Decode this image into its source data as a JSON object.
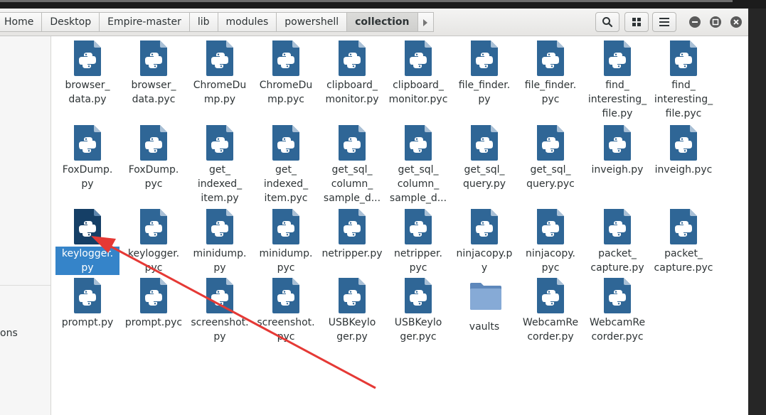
{
  "breadcrumbs": [
    "Home",
    "Desktop",
    "Empire-master",
    "lib",
    "modules",
    "powershell",
    "collection"
  ],
  "toolbar": {
    "search_icon": "search-icon",
    "view_icon": "grid-view-icon",
    "menu_icon": "hamburger-menu-icon"
  },
  "sidebar": {
    "partial_item": "ons"
  },
  "colors": {
    "selection": "#3584c9",
    "file_icon": "#2f6696",
    "folder": "#7aa2d0",
    "arrow": "#e53935"
  },
  "files": [
    {
      "name": "browser_\ndata.py",
      "type": "python"
    },
    {
      "name": "browser_\ndata.pyc",
      "type": "python"
    },
    {
      "name": "ChromeDu\nmp.py",
      "type": "python"
    },
    {
      "name": "ChromeDu\nmp.pyc",
      "type": "python"
    },
    {
      "name": "clipboard_\nmonitor.py",
      "type": "python"
    },
    {
      "name": "clipboard_\nmonitor.pyc",
      "type": "python"
    },
    {
      "name": "file_finder.\npy",
      "type": "python"
    },
    {
      "name": "file_finder.\npyc",
      "type": "python"
    },
    {
      "name": "find_\ninteresting_\nfile.py",
      "type": "python"
    },
    {
      "name": "find_\ninteresting_\nfile.pyc",
      "type": "python"
    },
    {
      "name": "FoxDump.\npy",
      "type": "python"
    },
    {
      "name": "FoxDump.\npyc",
      "type": "python"
    },
    {
      "name": "get_\nindexed_\nitem.py",
      "type": "python"
    },
    {
      "name": "get_\nindexed_\nitem.pyc",
      "type": "python"
    },
    {
      "name": "get_sql_\ncolumn_\nsample_d...",
      "type": "python"
    },
    {
      "name": "get_sql_\ncolumn_\nsample_d...",
      "type": "python"
    },
    {
      "name": "get_sql_\nquery.py",
      "type": "python"
    },
    {
      "name": "get_sql_\nquery.pyc",
      "type": "python"
    },
    {
      "name": "inveigh.py",
      "type": "python"
    },
    {
      "name": "inveigh.pyc",
      "type": "python"
    },
    {
      "name": "keylogger.\npy",
      "type": "python",
      "selected": true
    },
    {
      "name": "keylogger.\npyc",
      "type": "python"
    },
    {
      "name": "minidump.\npy",
      "type": "python"
    },
    {
      "name": "minidump.\npyc",
      "type": "python"
    },
    {
      "name": "netripper.py",
      "type": "python"
    },
    {
      "name": "netripper.\npyc",
      "type": "python"
    },
    {
      "name": "ninjacopy.py",
      "type": "python"
    },
    {
      "name": "ninjacopy.\npyc",
      "type": "python"
    },
    {
      "name": "packet_\ncapture.py",
      "type": "python"
    },
    {
      "name": "packet_\ncapture.pyc",
      "type": "python"
    },
    {
      "name": "prompt.py",
      "type": "python"
    },
    {
      "name": "prompt.pyc",
      "type": "python"
    },
    {
      "name": "screenshot.\npy",
      "type": "python"
    },
    {
      "name": "screenshot.\npyc",
      "type": "python"
    },
    {
      "name": "USBKeylo\nger.py",
      "type": "python"
    },
    {
      "name": "USBKeylo\nger.pyc",
      "type": "python"
    },
    {
      "name": "vaults",
      "type": "folder"
    },
    {
      "name": "WebcamRe\ncorder.py",
      "type": "python"
    },
    {
      "name": "WebcamRe\ncorder.pyc",
      "type": "python"
    }
  ]
}
